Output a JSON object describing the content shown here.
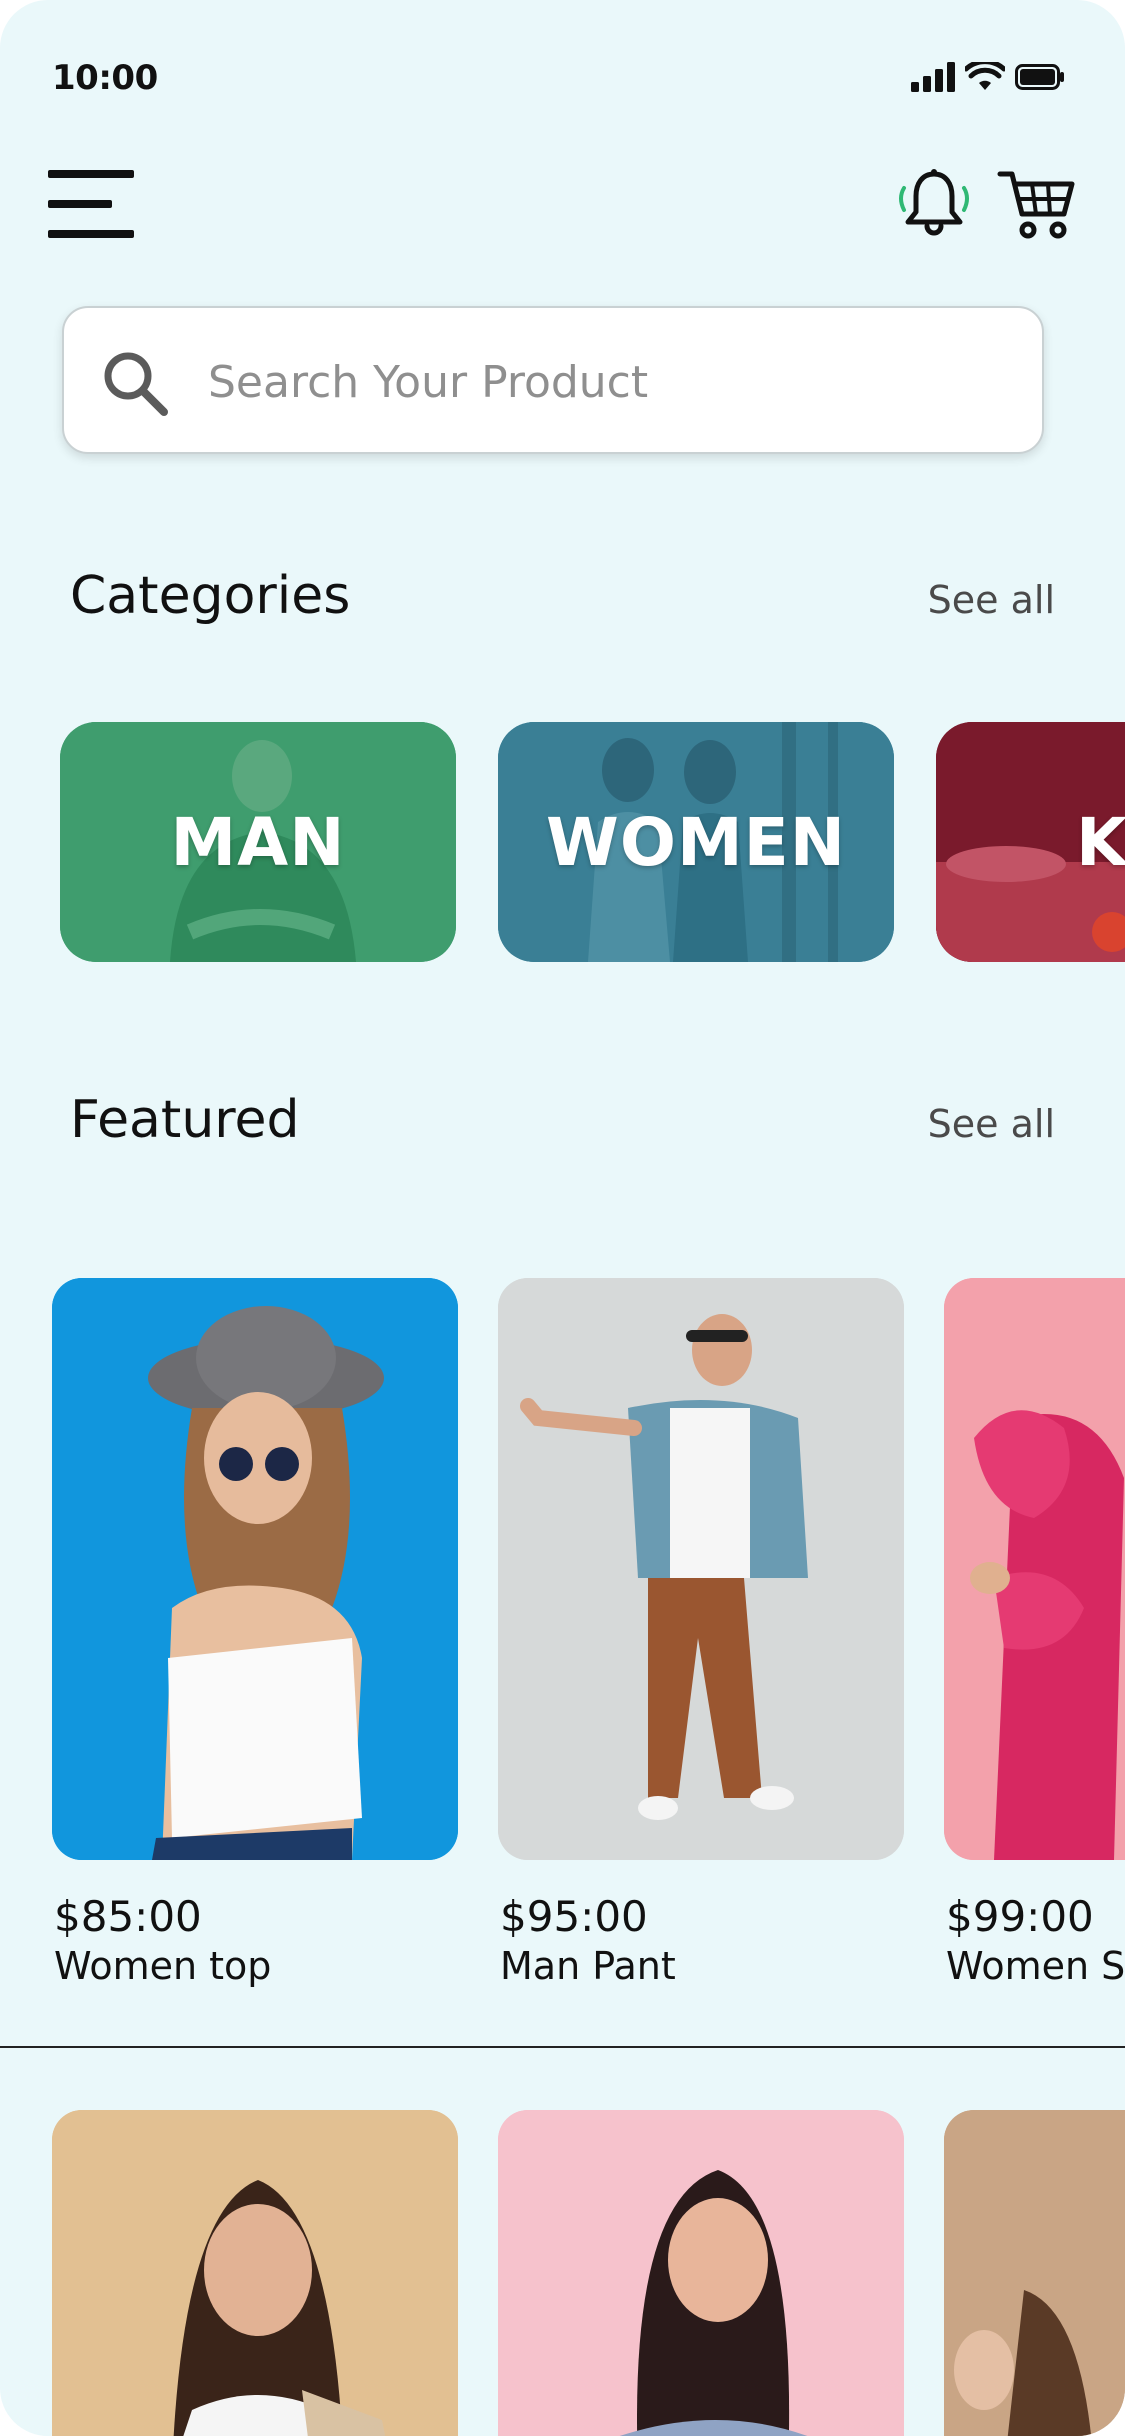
{
  "status_bar": {
    "time": "10:00",
    "icons": [
      "signal-icon",
      "wifi-icon",
      "battery-icon"
    ]
  },
  "header": {
    "menu_icon": "hamburger-menu-icon",
    "notification_icon": "bell-icon",
    "cart_icon": "shopping-cart-icon"
  },
  "search": {
    "placeholder": "Search Your Product",
    "value": ""
  },
  "categories": {
    "title": "Categories",
    "see_all": "See all",
    "items": [
      {
        "label": "MAN",
        "color": "#3f9d6e"
      },
      {
        "label": "WOMEN",
        "color": "#3a7f95"
      },
      {
        "label": "K",
        "color": "#8b1e33"
      }
    ]
  },
  "featured": {
    "title": "Featured",
    "see_all": "See all",
    "products": [
      {
        "price": "$85:00",
        "name": "Women top",
        "bg": "#1196dd"
      },
      {
        "price": "$95:00",
        "name": "Man Pant",
        "bg": "#d6d9d9"
      },
      {
        "price": "$99:00",
        "name": "Women Sh",
        "bg": "#f3a1ab"
      }
    ],
    "second_row": [
      {
        "bg": "#e2c092"
      },
      {
        "bg": "#f6c2cc"
      },
      {
        "bg": "#c9a585"
      }
    ]
  },
  "colors": {
    "background": "#eaf8fa",
    "notification_accent": "#2fb874"
  }
}
